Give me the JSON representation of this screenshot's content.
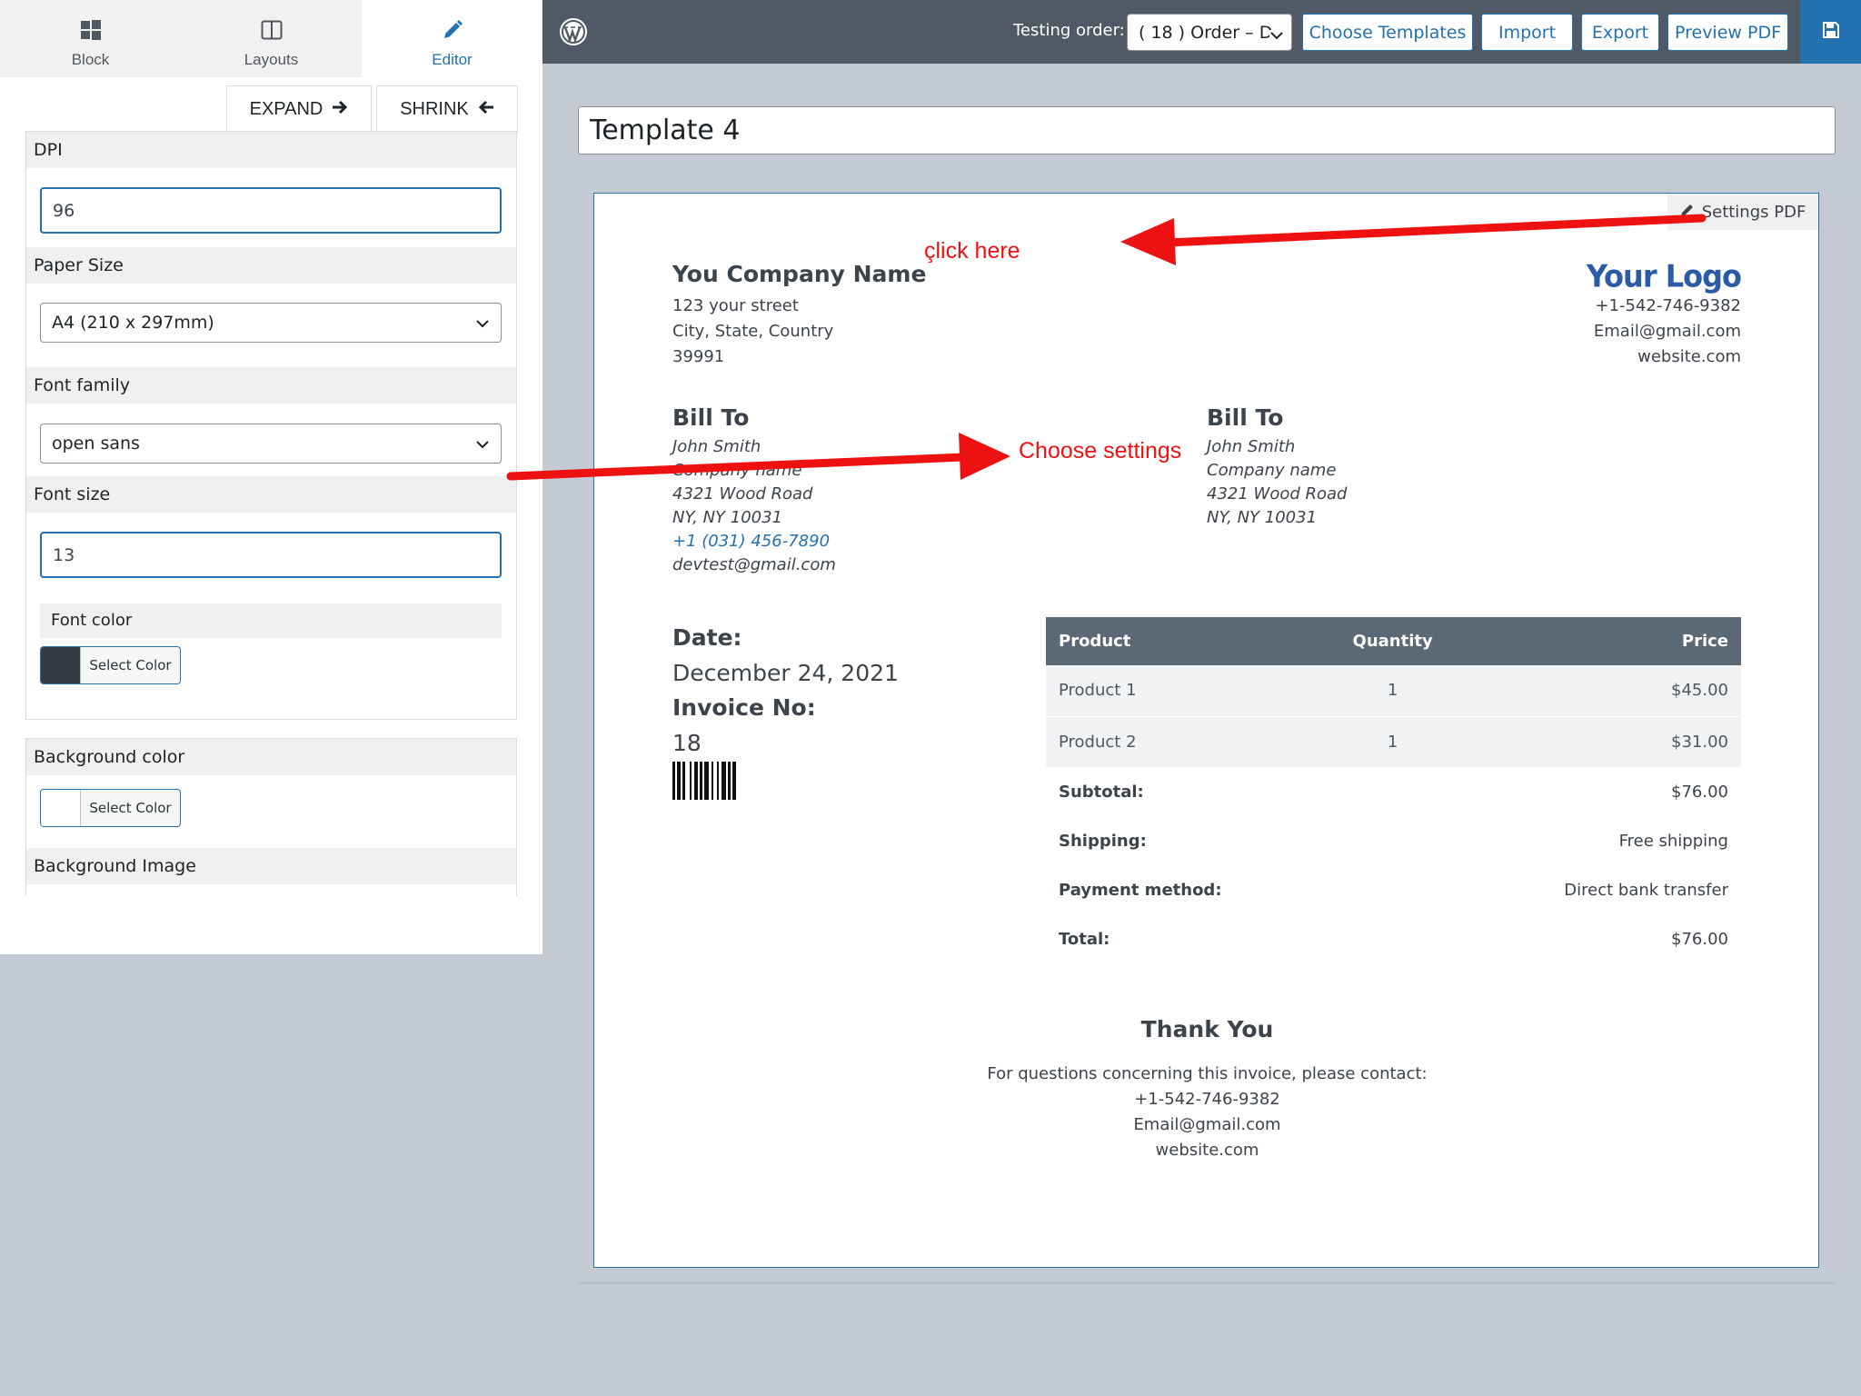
{
  "tabs": [
    {
      "label": "Block",
      "icon": "windows-icon"
    },
    {
      "label": "Layouts",
      "icon": "layout-icon"
    },
    {
      "label": "Editor",
      "icon": "pencil-icon"
    }
  ],
  "panel": {
    "expand_label": "EXPAND",
    "shrink_label": "SHRINK",
    "dpi_label": "DPI",
    "dpi_value": "96",
    "paper_label": "Paper Size",
    "paper_value": "A4 (210 x 297mm)",
    "font_family_label": "Font family",
    "font_family_value": "open sans",
    "font_size_label": "Font size",
    "font_size_value": "13",
    "font_color_label": "Font color",
    "font_color_button": "Select Color",
    "font_color_value": "#363b42",
    "bg_color_label": "Background color",
    "bg_color_button": "Select Color",
    "bg_color_value": "#ffffff",
    "bg_image_label": "Background Image"
  },
  "topbar": {
    "testing_label": "Testing order:",
    "order_value": "( 18 ) Order – D",
    "choose_templates": "Choose Templates",
    "import": "Import",
    "export": "Export",
    "preview": "Preview PDF"
  },
  "template_title": "Template 4",
  "invoice": {
    "settings_pdf": "Settings PDF",
    "company": {
      "name": "You Company Name",
      "street": "123 your street",
      "city": "City, State, Country",
      "zip": "39991"
    },
    "logo": "Your Logo",
    "contact": {
      "phone": "+1-542-746-9382",
      "email": "Email@gmail.com",
      "website": "website.com"
    },
    "bill_to_1": {
      "heading": "Bill To",
      "name": "John Smith",
      "company": "Company name",
      "street": "4321 Wood Road",
      "city": "NY, NY 10031",
      "phone": "+1 (031) 456-7890",
      "email": "devtest@gmail.com"
    },
    "bill_to_2": {
      "heading": "Bill To",
      "name": "John Smith",
      "company": "Company name",
      "street": "4321 Wood Road",
      "city": "NY, NY 10031"
    },
    "date_label": "Date:",
    "date_value": "December 24, 2021",
    "invoice_no_label": "Invoice No:",
    "invoice_no_value": "18",
    "table": {
      "headers": [
        "Product",
        "Quantity",
        "Price"
      ],
      "rows": [
        {
          "product": "Product 1",
          "qty": "1",
          "price": "$45.00"
        },
        {
          "product": "Product 2",
          "qty": "1",
          "price": "$31.00"
        }
      ],
      "totals": [
        {
          "label": "Subtotal:",
          "value": "$76.00"
        },
        {
          "label": "Shipping:",
          "value": "Free shipping"
        },
        {
          "label": "Payment method:",
          "value": "Direct bank transfer"
        },
        {
          "label": "Total:",
          "value": "$76.00"
        }
      ]
    },
    "thank_you": "Thank You",
    "footer": {
      "question": "For questions concerning this invoice, please contact:",
      "phone": "+1-542-746-9382",
      "email": "Email@gmail.com",
      "website": "website.com"
    }
  },
  "annotations": {
    "click_here": "çlick here",
    "choose_settings": "Choose settings",
    "color": "#ee1111"
  }
}
